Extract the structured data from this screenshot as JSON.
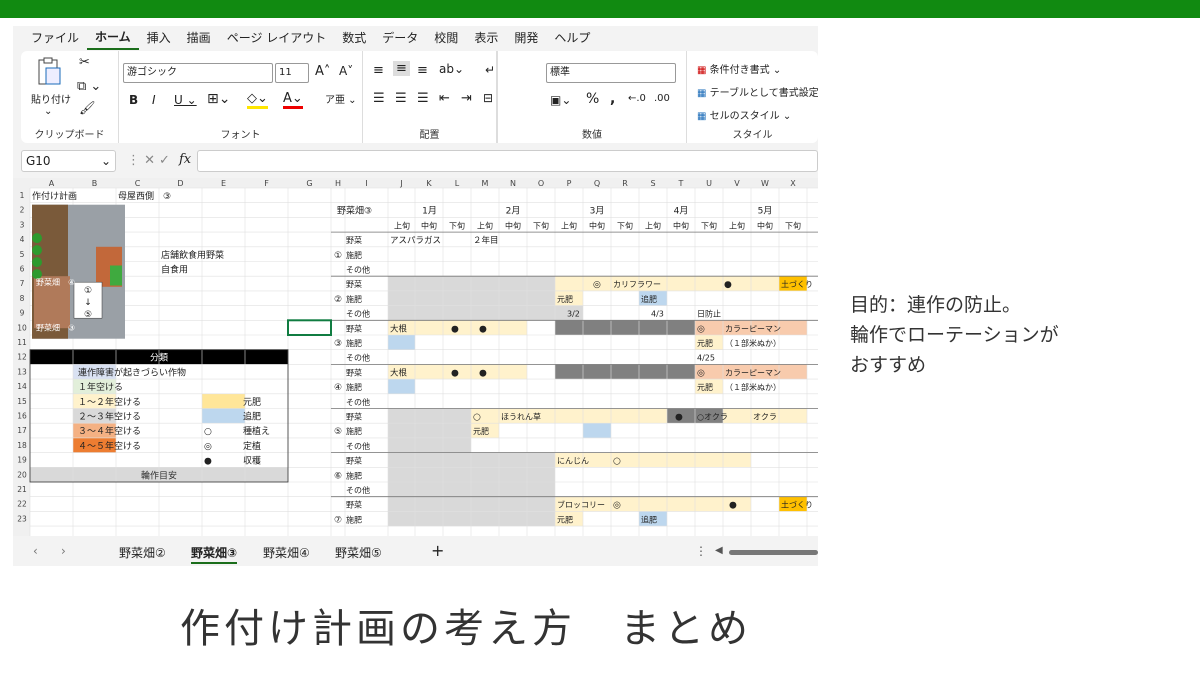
{
  "menu": [
    "ファイル",
    "ホーム",
    "挿入",
    "描画",
    "ページ レイアウト",
    "数式",
    "データ",
    "校閲",
    "表示",
    "開発",
    "ヘルプ"
  ],
  "ribbon": {
    "clipboard": {
      "paste": "貼り付け",
      "label": "クリップボード"
    },
    "font": {
      "name": "游ゴシック",
      "size": "11",
      "label": "フォント"
    },
    "align": {
      "label": "配置"
    },
    "number": {
      "format": "標準",
      "label": "数値"
    },
    "style": {
      "cond": "条件付き書式",
      "table": "テーブルとして書式設定",
      "cell": "セルのスタイル",
      "label": "スタイル"
    }
  },
  "namebox": "G10",
  "colors": {
    "blue": "#d9e1f2",
    "green": "#e2efda",
    "lightyellow": "#fff2cc",
    "yellow": "#ffe699",
    "pink": "#f8cbad",
    "orange": "#f4b183",
    "deep": "#ed7d31",
    "gray": "#d9d9d9",
    "dark": "#808080",
    "rowblue": "#bdd7ee",
    "gold": "#ffc000"
  },
  "cols": [
    "A",
    "B",
    "C",
    "D",
    "E",
    "F",
    "G",
    "H",
    "I",
    "J",
    "K",
    "L",
    "M",
    "N",
    "O",
    "P",
    "Q",
    "R",
    "S",
    "T",
    "U",
    "V",
    "W",
    "X"
  ],
  "rows": [
    "1",
    "2",
    "3",
    "4",
    "5",
    "6",
    "7",
    "8",
    "9",
    "10",
    "11",
    "12",
    "13",
    "14",
    "15",
    "16",
    "17",
    "18",
    "19",
    "20",
    "21",
    "22",
    "23"
  ],
  "left": {
    "a1": "作付け計画",
    "c1": "母屋西側　③",
    "c5": "店舗飲食用野菜",
    "c6": "自食用",
    "map_label1": "野菜畑　④",
    "map_label2": "野菜畑　③",
    "arrow": [
      "①",
      "↓",
      "⑤"
    ]
  },
  "legend": {
    "title": "分類",
    "items": [
      "連作障害が起きづらい作物",
      "１年空ける",
      "１～２年空ける",
      "２～３年空ける",
      "３～４年空ける",
      "４～５年空ける"
    ],
    "side": [
      "元肥",
      "追肥",
      "種植え",
      "定植",
      "収穫"
    ],
    "symbols": [
      "○",
      "◎",
      "●"
    ],
    "footer": "輪作目安"
  },
  "sched": {
    "title": "野菜畑③",
    "months": [
      "1月",
      "2月",
      "3月",
      "4月",
      "5月"
    ],
    "periods": [
      "上旬",
      "中旬",
      "下旬"
    ],
    "block_labels": [
      "①",
      "②",
      "③",
      "④",
      "⑤",
      "⑥",
      "⑦"
    ],
    "row_kinds": [
      "野菜",
      "施肥",
      "その他"
    ],
    "texts": {
      "asparagus": "アスパラガス",
      "year2": "２年目",
      "circle_dbl": "◎",
      "cauliflower": "カリフラワー",
      "dot": "●",
      "soil": "土づくり",
      "motohi": "元肥",
      "oihi": "追肥",
      "d32": "3/2",
      "d43": "4/3",
      "day_prevent": "日防止",
      "daikon": "大根",
      "pepper": "カラーピーマン",
      "rice": "（１部米ぬか）",
      "d425": "4/25",
      "circle": "○",
      "spinach": "ほうれん草",
      "okra_o": "○オクラ",
      "okra": "オクラ",
      "carrot": "にんじん",
      "broccoli": "ブロッコリー"
    }
  },
  "tabs": [
    "野菜畑②",
    "野菜畑③",
    "野菜畑④",
    "野菜畑⑤"
  ],
  "note": {
    "line1": "目的：連作の防止。",
    "line2": "輪作でローテーションが",
    "line3": "おすすめ"
  },
  "caption": "作付け計画の考え方　まとめ"
}
